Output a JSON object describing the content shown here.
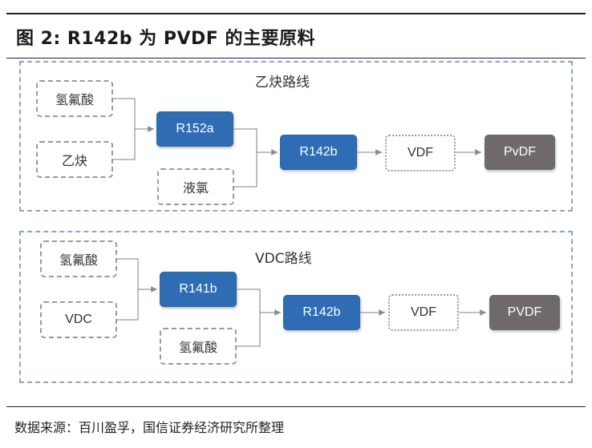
{
  "title": "图 2:  R142b 为 PVDF 的主要原料",
  "panels": [
    {
      "title": "乙炔路线",
      "inputs": [
        "氢氟酸",
        "乙炔"
      ],
      "intermediate": "R152a",
      "side_input": "液氯",
      "product": "R142b",
      "monomer": "VDF",
      "polymer": "PvDF"
    },
    {
      "title": "VDC路线",
      "inputs": [
        "氢氟酸",
        "VDC"
      ],
      "intermediate": "R141b",
      "side_input": "氢氟酸",
      "product": "R142b",
      "monomer": "VDF",
      "polymer": "PVDF"
    }
  ],
  "source": "数据来源：百川盈孚，国信证券经济研究所整理",
  "colors": {
    "intermediate_fill": "#2e6db4",
    "polymer_fill": "#6e6a6a",
    "panel_border": "#8aa6c4",
    "raw_border": "#9a9a9a"
  }
}
